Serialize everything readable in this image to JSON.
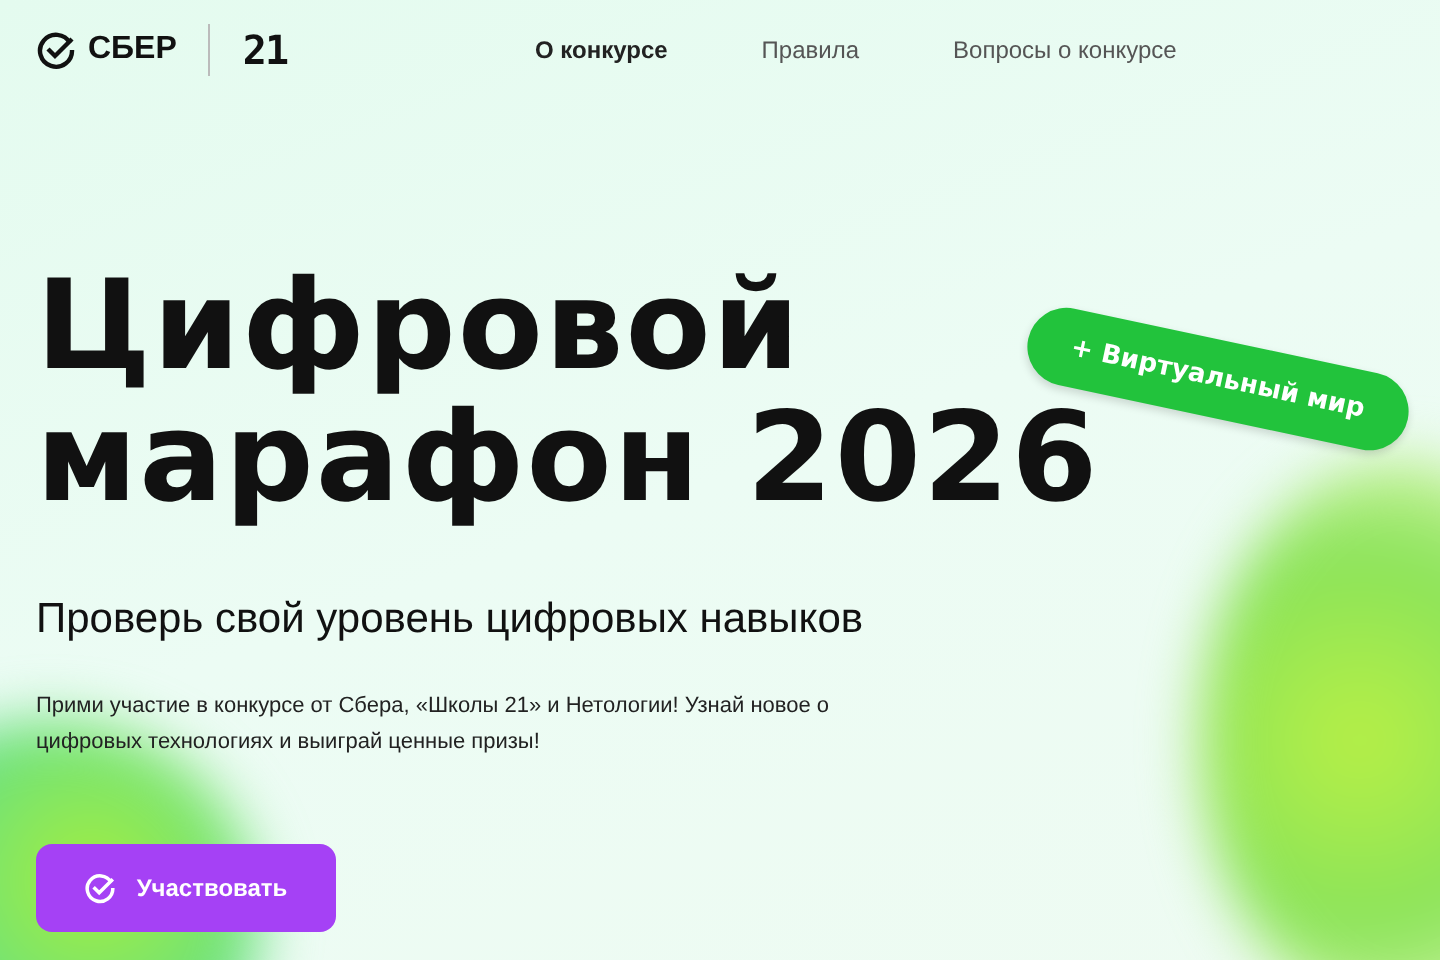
{
  "header": {
    "logo": "СБЕР",
    "logo_21": "21",
    "nav": [
      {
        "label": "О конкурсе",
        "selected": true
      },
      {
        "label": "Правила",
        "selected": false
      },
      {
        "label": "Вопросы о конкурсе",
        "selected": false
      }
    ]
  },
  "hero": {
    "title_lines": [
      "Цифровой",
      "марафон 2026"
    ],
    "badge": "+ Виртуальный мир",
    "subtitle": "Проверь свой уровень цифровых навыков",
    "description": "Прими участие в конкурсе от Сбера, «Школы 21» и Нетологии! Узнай новое о цифровых технологиях и выиграй ценные призы!",
    "button": "Участвовать"
  }
}
